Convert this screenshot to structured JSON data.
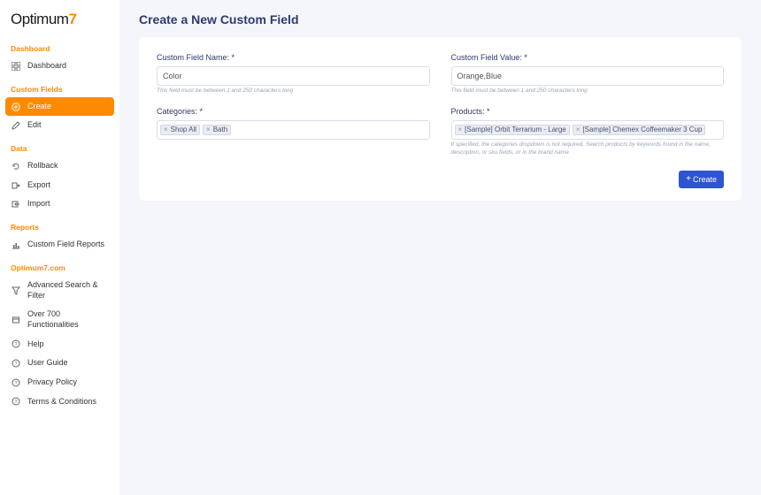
{
  "logo": {
    "text": "Optimum",
    "accent": "7"
  },
  "sidebar": {
    "sections": {
      "dashboard_label": "Dashboard",
      "custom_fields_label": "Custom Fields",
      "data_label": "Data",
      "reports_label": "Reports",
      "optimum7_label": "Optimum7.com"
    },
    "dashboard_item": "Dashboard",
    "create_item": "Create",
    "edit_item": "Edit",
    "rollback_item": "Rollback",
    "export_item": "Export",
    "import_item": "Import",
    "custom_field_reports_item": "Custom Field Reports",
    "advanced_search_item": "Advanced Search & Filter",
    "functionalities_item": "Over 700 Functionalities",
    "help_item": "Help",
    "user_guide_item": "User Guide",
    "privacy_item": "Privacy Policy",
    "terms_item": "Terms & Conditions"
  },
  "page": {
    "title": "Create a New Custom Field"
  },
  "form": {
    "name_label": "Custom Field Name: *",
    "name_value": "Color",
    "name_hint": "This field must be between 1 and 250 characters long",
    "value_label": "Custom Field Value: *",
    "value_value": "Orange,Blue",
    "value_hint": "This field must be between 1 and 250 characters long",
    "categories_label": "Categories: *",
    "categories": [
      "Shop All",
      "Bath"
    ],
    "products_label": "Products: *",
    "products": [
      "[Sample] Orbit Terrarium - Large",
      "[Sample] Chemex Coffeemaker 3 Cup"
    ],
    "products_hint": "If specified, the categories dropdown is not required. Search products by keywords found in the name, description, or sku fields, or in the brand name",
    "create_button": "Create"
  }
}
